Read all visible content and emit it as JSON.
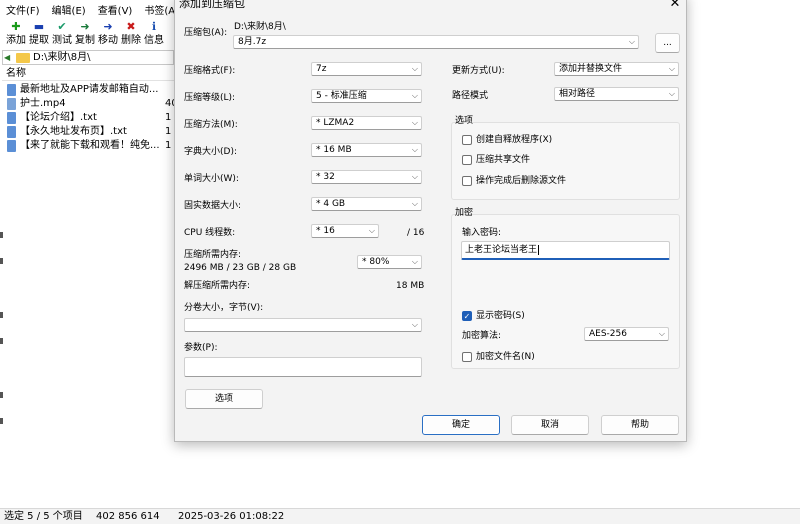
{
  "menubar": [
    "文件(F)",
    "编辑(E)",
    "查看(V)",
    "书签(A)"
  ],
  "toolbar": [
    {
      "label": "添加",
      "icon": "add-icon",
      "color": "#1a9a1a",
      "glyph": "✚"
    },
    {
      "label": "提取",
      "icon": "extract-icon",
      "color": "#1a3fb0",
      "glyph": "▬"
    },
    {
      "label": "测试",
      "icon": "test-icon",
      "color": "#1a9a6a",
      "glyph": "✔"
    },
    {
      "label": "复制",
      "icon": "copy-icon",
      "color": "#1a7a3a",
      "glyph": "➜"
    },
    {
      "label": "移动",
      "icon": "move-icon",
      "color": "#1a3fb0",
      "glyph": "➜"
    },
    {
      "label": "删除",
      "icon": "delete-icon",
      "color": "#c81a1a",
      "glyph": "✖"
    },
    {
      "label": "信息",
      "icon": "info-icon",
      "color": "#1a4fb0",
      "glyph": "ℹ"
    }
  ],
  "address_path": "D:\\来财\\8月\\",
  "filelist_header": "名称",
  "files": [
    {
      "name": "最新地址及APP请发邮箱自动...",
      "size": "",
      "type": "text"
    },
    {
      "name": "护士.mp4",
      "size": "40",
      "type": "video"
    },
    {
      "name": "【论坛介绍】.txt",
      "size": "1",
      "type": "text"
    },
    {
      "name": "【永久地址发布页】.txt",
      "size": "1",
      "type": "text"
    },
    {
      "name": "【来了就能下载和观看！纯免...",
      "size": "1",
      "type": "text"
    }
  ],
  "status": {
    "selection": "选定 5 / 5 个项目",
    "size": "402 856 614",
    "date": "2025-03-26 01:08:22"
  },
  "dialog": {
    "title": "添加到压缩包",
    "close_glyph": "✕",
    "archive_label": "压缩包(A):",
    "archive_dir": "D:\\来财\\8月\\",
    "archive_name": "8月.7z",
    "browse_label": "...",
    "format_label": "压缩格式(F):",
    "format_value": "7z",
    "level_label": "压缩等级(L):",
    "level_value": "5 - 标准压缩",
    "method_label": "压缩方法(M):",
    "method_value": "*  LZMA2",
    "dict_label": "字典大小(D):",
    "dict_value": "*  16 MB",
    "word_label": "单词大小(W):",
    "word_value": "*  32",
    "solid_label": "固实数据大小:",
    "solid_value": "*  4 GB",
    "cpu_label": "CPU 线程数:",
    "cpu_value": "*  16",
    "cpu_total": "/ 16",
    "mem_comp_label": "压缩所需内存:",
    "mem_comp_value": "2496 MB / 23 GB / 28 GB",
    "mem_percent": "* 80%",
    "mem_decomp_label": "解压缩所需内存:",
    "mem_decomp_value": "18 MB",
    "split_label": "分卷大小，字节(V):",
    "split_value": "",
    "params_label": "参数(P):",
    "params_value": "",
    "options_button": "选项",
    "update_label": "更新方式(U):",
    "update_value": "添加并替换文件",
    "path_label": "路径模式",
    "path_value": "相对路径",
    "options_group": "选项",
    "opt_sfx": "创建自释放程序(X)",
    "opt_shared": "压缩共享文件",
    "opt_delete": "操作完成后删除源文件",
    "encrypt_group": "加密",
    "password_label": "输入密码:",
    "password_value": "上老王论坛当老王",
    "show_password": "显示密码(S)",
    "enc_method_label": "加密算法:",
    "enc_method_value": "AES-256",
    "enc_names": "加密文件名(N)",
    "ok_button": "确定",
    "cancel_button": "取消",
    "help_button": "帮助"
  }
}
